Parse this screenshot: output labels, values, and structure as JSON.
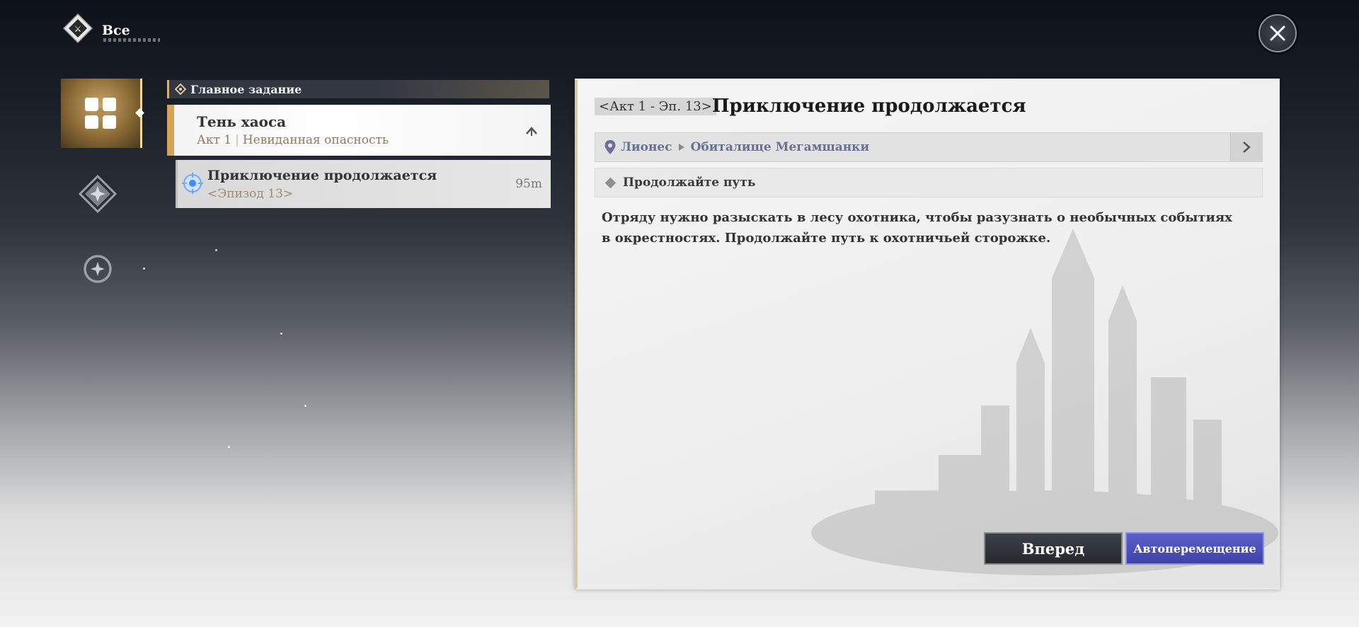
{
  "header": {
    "title": "Все"
  },
  "sidebar": {
    "categories": [
      {
        "name": "main-quests",
        "icon": "four-diamond-icon",
        "active": true
      },
      {
        "name": "side-quests",
        "icon": "star-diamond-icon",
        "active": false
      },
      {
        "name": "other-quests",
        "icon": "star-circle-icon",
        "active": false
      }
    ]
  },
  "quest_list": {
    "section_label": "Главное задание",
    "chapter": {
      "name": "Тень хаоса",
      "act": "Акт 1",
      "subtitle": "Невиданная опасность"
    },
    "items": [
      {
        "name": "Приключение продолжается",
        "episode": "<Эпизод 13>",
        "distance": "95m"
      }
    ]
  },
  "detail": {
    "episode_tag": "<Акт 1 - Эп. 13>",
    "title": "Приключение продолжается",
    "location": {
      "region": "Лионес",
      "place": "Обиталище Мегамшанки"
    },
    "objective": "Продолжайте путь",
    "description": "Отряду нужно разыскать в лесу охотника, чтобы разузнать о необычных событиях в окрестностях. Продолжайте путь к охотничьей сторожке.",
    "buttons": {
      "forward": "Вперед",
      "auto": "Автоперемещение"
    }
  },
  "colors": {
    "accent_gold": "#d9a25a",
    "accent_blue": "#4a4fbf",
    "location_text": "#6b6f94"
  }
}
